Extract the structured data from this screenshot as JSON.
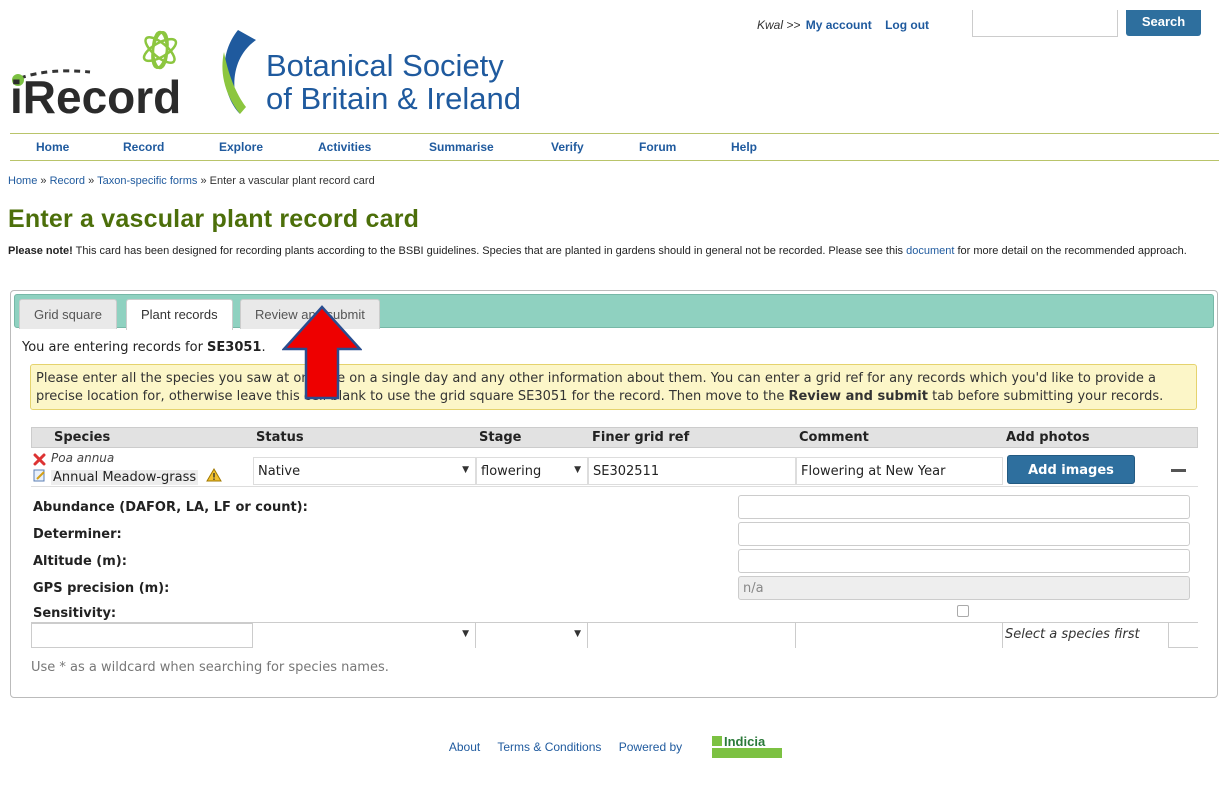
{
  "header": {
    "irecord_logo": "iRecord",
    "bsbi_line1": "Botanical Society",
    "bsbi_line2": "of Britain & Ireland",
    "user": "Kwal >>",
    "my_account": "My account",
    "logout": "Log out",
    "search_value": "",
    "search_label": "Search"
  },
  "nav": [
    "Home",
    "Record",
    "Explore",
    "Activities",
    "Summarise",
    "Verify",
    "Forum",
    "Help"
  ],
  "breadcrumb": {
    "home": "Home",
    "sep": "»",
    "record": "Record",
    "taxon": "Taxon-specific forms",
    "current": "Enter a vascular plant record card"
  },
  "page_title": "Enter a vascular plant record card",
  "note": {
    "bold": "Please note!",
    "text1": " This card has been designed for recording plants according to the BSBI guidelines. Species that are planted in gardens should in general not be recorded. Please see this ",
    "link": "document",
    "text2": " for more detail on the recommended approach."
  },
  "tabs": [
    "Grid square",
    "Plant records",
    "Review and submit"
  ],
  "entering": {
    "prefix": "You are entering records for ",
    "square": "SE3051",
    "suffix": "."
  },
  "info": {
    "part1": "Please enter all the species you saw at one site on a single day and any other information about them. You can enter a grid ref for any records which you'd like to provide a precise location for, otherwise leave this cell blank to use the grid square SE3051 for the record. Then move to the ",
    "bold": "Review and submit",
    "part2": " tab before submitting your records."
  },
  "grid": {
    "headers": [
      "Species",
      "Status",
      "Stage",
      "Finer grid ref",
      "Comment",
      "Add photos"
    ],
    "row": {
      "latin": "Poa annua",
      "common": "Annual Meadow-grass",
      "status": "Native",
      "stage": "flowering",
      "gridref": "SE302511",
      "comment": "Flowering at New Year",
      "add_images": "Add images"
    },
    "attrs": [
      {
        "label": "Abundance (DAFOR, LA, LF or count):",
        "value": ""
      },
      {
        "label": "Determiner:",
        "value": ""
      },
      {
        "label": "Altitude (m):",
        "value": ""
      },
      {
        "label": "GPS precision (m):",
        "value": "n/a"
      },
      {
        "label": "Sensitivity:",
        "value": ""
      }
    ],
    "empty_row_photos": "Select a species first"
  },
  "hint": "Use * as a wildcard when searching for species names.",
  "footer": {
    "about": "About",
    "terms": "Terms & Conditions",
    "powered": "Powered by",
    "indicia": "Indicia"
  }
}
